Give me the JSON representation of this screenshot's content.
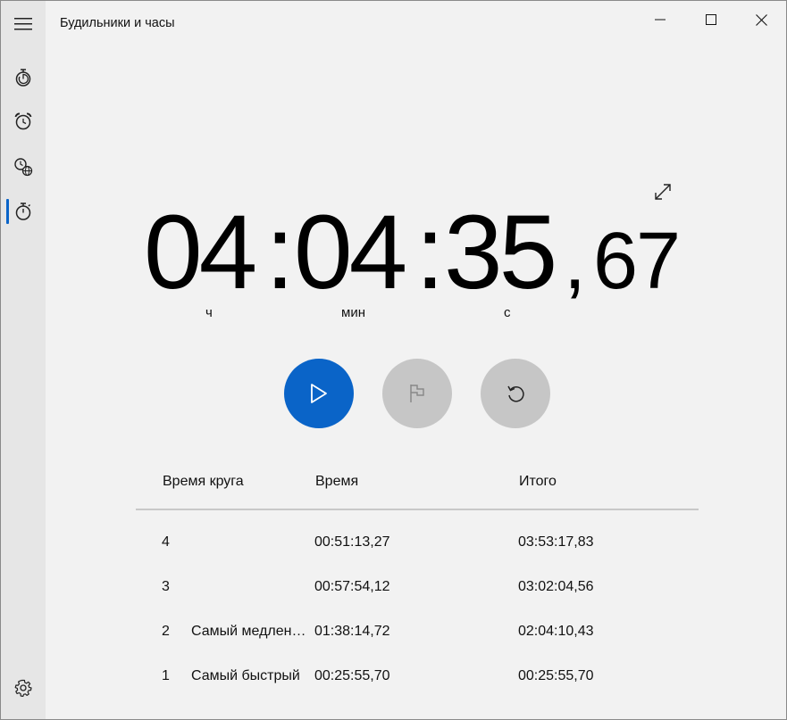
{
  "app": {
    "title": "Будильники и часы"
  },
  "window_controls": [
    "minimize",
    "maximize",
    "close"
  ],
  "sidebar": {
    "items": [
      {
        "icon": "hamburger-menu-icon"
      },
      {
        "icon": "timer-icon"
      },
      {
        "icon": "alarm-clock-icon"
      },
      {
        "icon": "world-clock-icon"
      },
      {
        "icon": "stopwatch-icon",
        "selected": true
      }
    ],
    "settings_icon": "gear-icon"
  },
  "stopwatch": {
    "hours": "04",
    "minutes": "04",
    "seconds": "35",
    "separator": ":",
    "decimal_separator": ",",
    "hundredths": "67",
    "unit_hours": "ч",
    "unit_minutes": "мин",
    "unit_seconds": "с"
  },
  "controls": {
    "play": "play-icon",
    "lap": "flag-icon",
    "reset": "reset-icon"
  },
  "laps": {
    "headers": {
      "lap_time": "Время круга",
      "time": "Время",
      "total": "Итого"
    },
    "rows": [
      {
        "number": "4",
        "label": "",
        "time": "00:51:13,27",
        "total": "03:53:17,83"
      },
      {
        "number": "3",
        "label": "",
        "time": "00:57:54,12",
        "total": "03:02:04,56"
      },
      {
        "number": "2",
        "label": "Самый медлен…",
        "time": "01:38:14,72",
        "total": "02:04:10,43"
      },
      {
        "number": "1",
        "label": "Самый быстрый",
        "time": "00:25:55,70",
        "total": "00:25:55,70"
      }
    ]
  },
  "colors": {
    "accent": "#0a64c8",
    "disabled_button": "#c6c6c6",
    "sidebar_bg": "#e6e6e6",
    "content_bg": "#f2f2f2"
  }
}
